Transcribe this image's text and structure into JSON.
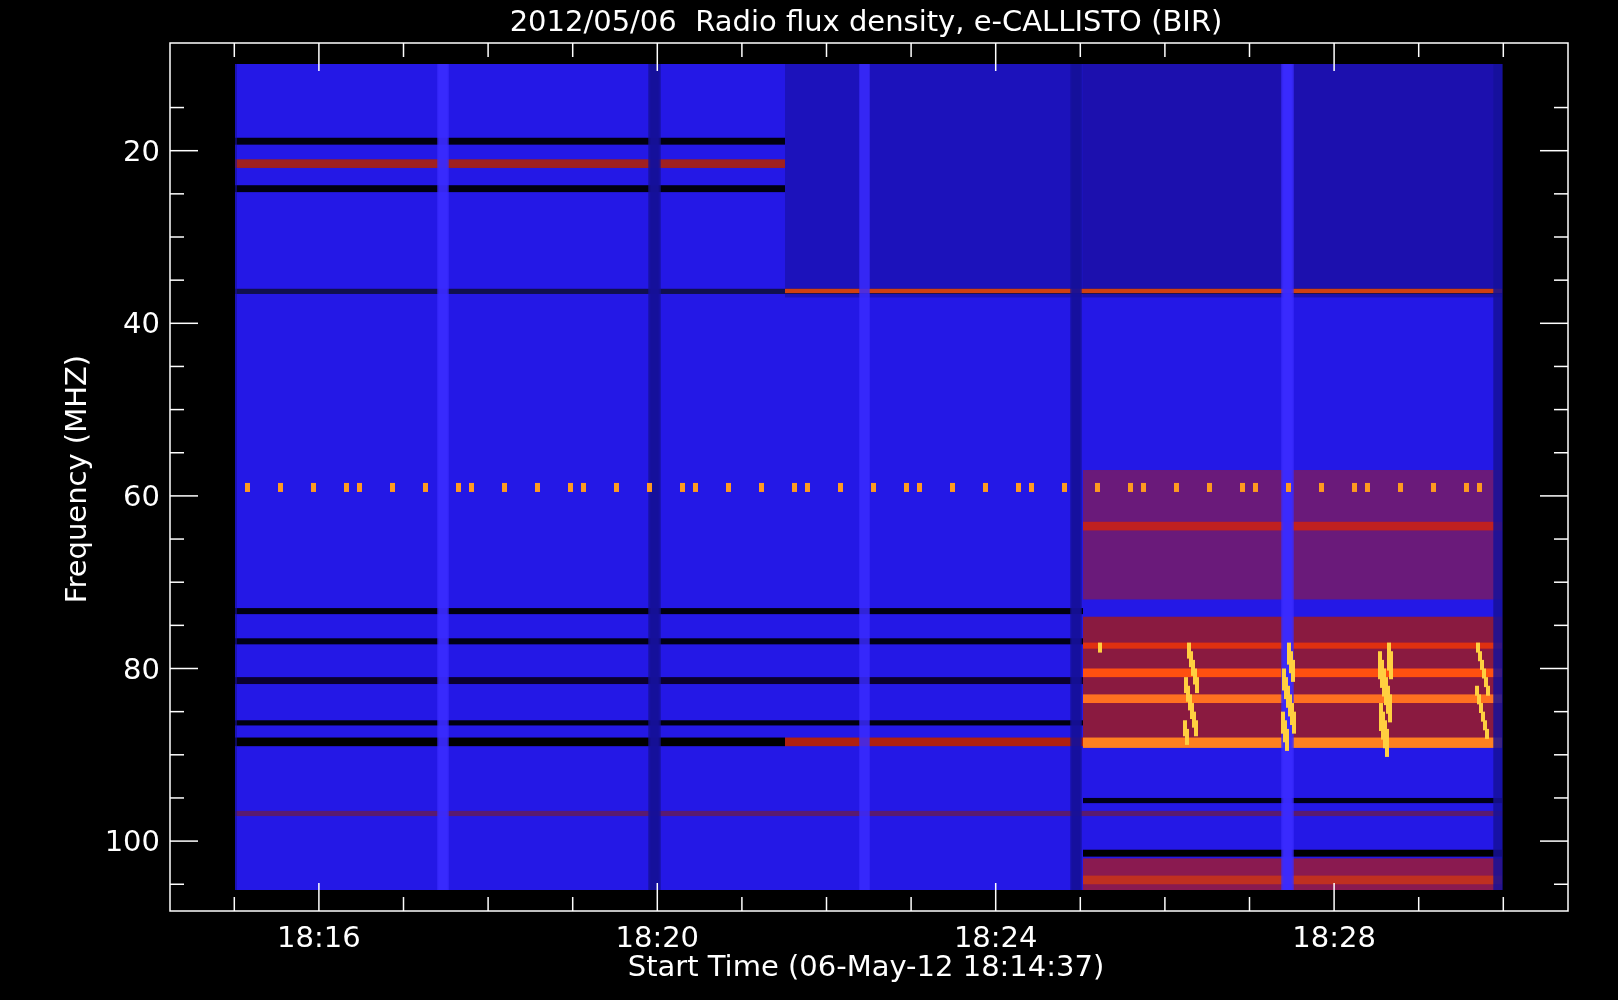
{
  "title": "2012/05/06  Radio flux density, e-CALLISTO (BIR)",
  "x_axis": {
    "label": "Start Time (06-May-12 18:14:37)",
    "ticks": [
      "18:16",
      "18:20",
      "18:24",
      "18:28"
    ]
  },
  "y_axis": {
    "label": "Frequency (MHZ)",
    "ticks": [
      "20",
      "40",
      "60",
      "80",
      "100"
    ]
  }
}
